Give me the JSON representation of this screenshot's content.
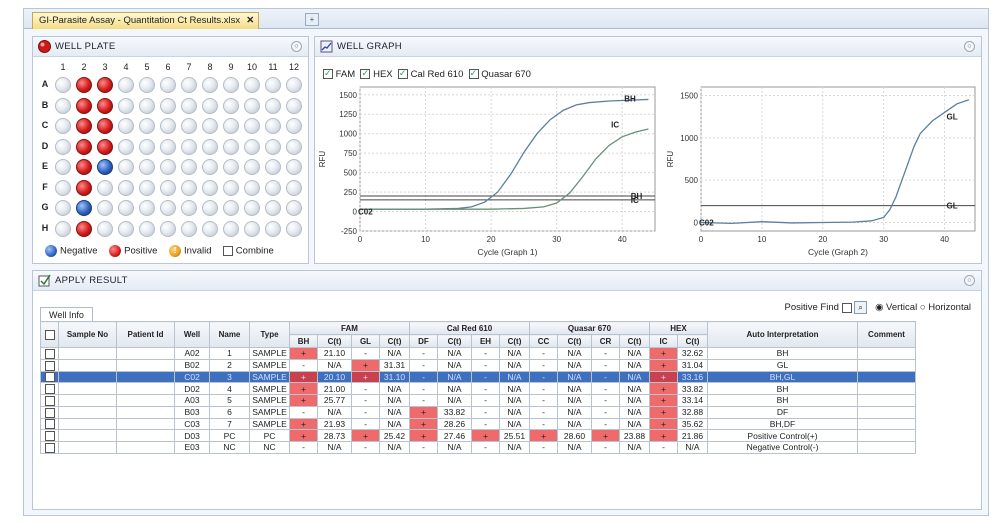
{
  "document_tab": {
    "title": "GI-Parasite Assay - Quantitation Ct Results.xlsx",
    "close": "✕",
    "add": "+"
  },
  "well_plate": {
    "title": "WELL PLATE",
    "columns": [
      "1",
      "2",
      "3",
      "4",
      "5",
      "6",
      "7",
      "8",
      "9",
      "10",
      "11",
      "12"
    ],
    "rows": [
      "A",
      "B",
      "C",
      "D",
      "E",
      "F",
      "G",
      "H"
    ],
    "wells": [
      [
        "e",
        "pos",
        "pos",
        "e",
        "e",
        "e",
        "e",
        "e",
        "e",
        "e",
        "e",
        "e"
      ],
      [
        "e",
        "pos",
        "pos",
        "e",
        "e",
        "e",
        "e",
        "e",
        "e",
        "e",
        "e",
        "e"
      ],
      [
        "e",
        "pos",
        "pos",
        "e",
        "e",
        "e",
        "e",
        "e",
        "e",
        "e",
        "e",
        "e"
      ],
      [
        "e",
        "pos",
        "pos",
        "e",
        "e",
        "e",
        "e",
        "e",
        "e",
        "e",
        "e",
        "e"
      ],
      [
        "e",
        "pos",
        "neg",
        "e",
        "e",
        "e",
        "e",
        "e",
        "e",
        "e",
        "e",
        "e"
      ],
      [
        "e",
        "pos",
        "e",
        "e",
        "e",
        "e",
        "e",
        "e",
        "e",
        "e",
        "e",
        "e"
      ],
      [
        "e",
        "neg",
        "e",
        "e",
        "e",
        "e",
        "e",
        "e",
        "e",
        "e",
        "e",
        "e"
      ],
      [
        "e",
        "pos",
        "e",
        "e",
        "e",
        "e",
        "e",
        "e",
        "e",
        "e",
        "e",
        "e"
      ]
    ],
    "legend": {
      "negative": "Negative",
      "positive": "Positive",
      "invalid": "Invalid",
      "combine": "Combine"
    },
    "colors": {
      "positive": "#d21c1c",
      "negative": "#2f63bd",
      "invalid": "#e8a020"
    }
  },
  "well_graph": {
    "title": "WELL GRAPH",
    "channels": [
      {
        "label": "FAM",
        "checked": true
      },
      {
        "label": "HEX",
        "checked": true
      },
      {
        "label": "Cal Red 610",
        "checked": true
      },
      {
        "label": "Quasar 670",
        "checked": true
      }
    ]
  },
  "chart_data": [
    {
      "type": "line",
      "xlabel": "Cycle (Graph 1)",
      "ylabel": "RFU",
      "xlim": [
        0,
        45
      ],
      "ylim": [
        -250,
        1600
      ],
      "xticks": [
        0,
        10,
        20,
        30,
        40
      ],
      "yticks": [
        -250,
        0,
        250,
        500,
        750,
        1000,
        1250,
        1500
      ],
      "series": [
        {
          "x": [
            0,
            5,
            10,
            15,
            17,
            19,
            21,
            23,
            25,
            27,
            29,
            31,
            33,
            35,
            38,
            41,
            44
          ],
          "y": [
            30,
            30,
            30,
            40,
            60,
            120,
            250,
            480,
            760,
            1000,
            1180,
            1300,
            1370,
            1400,
            1420,
            1430,
            1440
          ]
        },
        {
          "x": [
            0,
            5,
            10,
            15,
            20,
            25,
            28,
            30,
            32,
            34,
            36,
            38,
            40,
            42,
            44
          ],
          "y": [
            30,
            30,
            30,
            30,
            30,
            40,
            60,
            110,
            240,
            450,
            680,
            850,
            960,
            1020,
            1060
          ]
        }
      ],
      "thresholds": [
        200,
        150
      ],
      "annotations": [
        "BH",
        "IC",
        "BH",
        "IC",
        "C02"
      ]
    },
    {
      "type": "line",
      "xlabel": "Cycle (Graph 2)",
      "ylabel": "RFU",
      "xlim": [
        0,
        45
      ],
      "ylim": [
        -100,
        1600
      ],
      "xticks": [
        0,
        10,
        20,
        30,
        40
      ],
      "yticks": [
        0,
        500,
        1000,
        1500
      ],
      "series": [
        {
          "x": [
            0,
            5,
            10,
            15,
            20,
            25,
            28,
            30,
            31,
            32,
            33,
            34,
            35,
            36,
            38,
            40,
            42,
            44
          ],
          "y": [
            0,
            -10,
            10,
            -5,
            0,
            5,
            20,
            60,
            150,
            300,
            500,
            700,
            900,
            1050,
            1200,
            1300,
            1400,
            1450
          ]
        }
      ],
      "thresholds": [
        200
      ],
      "annotations": [
        "GL",
        "GL",
        "C02"
      ]
    }
  ],
  "apply_result": {
    "title": "APPLY RESULT",
    "subtab": "Well Info",
    "positive_find": "Positive Find",
    "orient_vertical": "Vertical",
    "orient_horizontal": "Horizontal",
    "group_headers": [
      "FAM",
      "Cal Red 610",
      "Quasar 670",
      "HEX"
    ],
    "col_sample": "Sample No",
    "col_patient": "Patient Id",
    "col_well": "Well",
    "col_name": "Name",
    "col_type": "Type",
    "col_interp": "Auto  Interpretation",
    "col_comment": "Comment",
    "sub_headers": [
      "BH",
      "C(t)",
      "GL",
      "C(t)",
      "DF",
      "C(t)",
      "EH",
      "C(t)",
      "CC",
      "C(t)",
      "CR",
      "C(t)",
      "IC",
      "C(t)"
    ],
    "rows": [
      {
        "well": "A02",
        "name": "1",
        "type": "SAMPLE",
        "vals": [
          "+",
          "21.10",
          "-",
          "N/A",
          "-",
          "N/A",
          "-",
          "N/A",
          "-",
          "N/A",
          "-",
          "N/A",
          "+",
          "32.62"
        ],
        "red": [
          0,
          12
        ],
        "interp": "BH",
        "sel": false
      },
      {
        "well": "B02",
        "name": "2",
        "type": "SAMPLE",
        "vals": [
          "-",
          "N/A",
          "+",
          "31.31",
          "-",
          "N/A",
          "-",
          "N/A",
          "-",
          "N/A",
          "-",
          "N/A",
          "+",
          "31.04"
        ],
        "red": [
          2,
          12
        ],
        "interp": "GL",
        "sel": false
      },
      {
        "well": "C02",
        "name": "3",
        "type": "SAMPLE",
        "vals": [
          "+",
          "20.10",
          "+",
          "31.10",
          "-",
          "N/A",
          "-",
          "N/A",
          "-",
          "N/A",
          "-",
          "N/A",
          "+",
          "33.16"
        ],
        "red": [
          0,
          2,
          12
        ],
        "interp": "BH,GL",
        "sel": true
      },
      {
        "well": "D02",
        "name": "4",
        "type": "SAMPLE",
        "vals": [
          "+",
          "21.00",
          "-",
          "N/A",
          "-",
          "N/A",
          "-",
          "N/A",
          "-",
          "N/A",
          "-",
          "N/A",
          "+",
          "33.82"
        ],
        "red": [
          0,
          12
        ],
        "interp": "BH",
        "sel": false
      },
      {
        "well": "A03",
        "name": "5",
        "type": "SAMPLE",
        "vals": [
          "+",
          "25.77",
          "-",
          "N/A",
          "-",
          "N/A",
          "-",
          "N/A",
          "-",
          "N/A",
          "-",
          "N/A",
          "+",
          "33.14"
        ],
        "red": [
          0,
          12
        ],
        "interp": "BH",
        "sel": false
      },
      {
        "well": "B03",
        "name": "6",
        "type": "SAMPLE",
        "vals": [
          "-",
          "N/A",
          "-",
          "N/A",
          "+",
          "33.82",
          "-",
          "N/A",
          "-",
          "N/A",
          "-",
          "N/A",
          "+",
          "32.88"
        ],
        "red": [
          4,
          12
        ],
        "interp": "DF",
        "sel": false
      },
      {
        "well": "C03",
        "name": "7",
        "type": "SAMPLE",
        "vals": [
          "+",
          "21.93",
          "-",
          "N/A",
          "+",
          "28.26",
          "-",
          "N/A",
          "-",
          "N/A",
          "-",
          "N/A",
          "+",
          "35.62"
        ],
        "red": [
          0,
          4,
          12
        ],
        "interp": "BH,DF",
        "sel": false
      },
      {
        "well": "D03",
        "name": "PC",
        "type": "PC",
        "vals": [
          "+",
          "28.73",
          "+",
          "25.42",
          "+",
          "27.46",
          "+",
          "25.51",
          "+",
          "28.60",
          "+",
          "23.88",
          "+",
          "21.86"
        ],
        "red": [
          0,
          2,
          4,
          6,
          8,
          10,
          12
        ],
        "interp": "Positive Control(+)",
        "sel": false
      },
      {
        "well": "E03",
        "name": "NC",
        "type": "NC",
        "vals": [
          "-",
          "N/A",
          "-",
          "N/A",
          "-",
          "N/A",
          "-",
          "N/A",
          "-",
          "N/A",
          "-",
          "N/A",
          "-",
          "N/A"
        ],
        "red": [],
        "interp": "Negative Control(-)",
        "sel": false
      }
    ]
  }
}
